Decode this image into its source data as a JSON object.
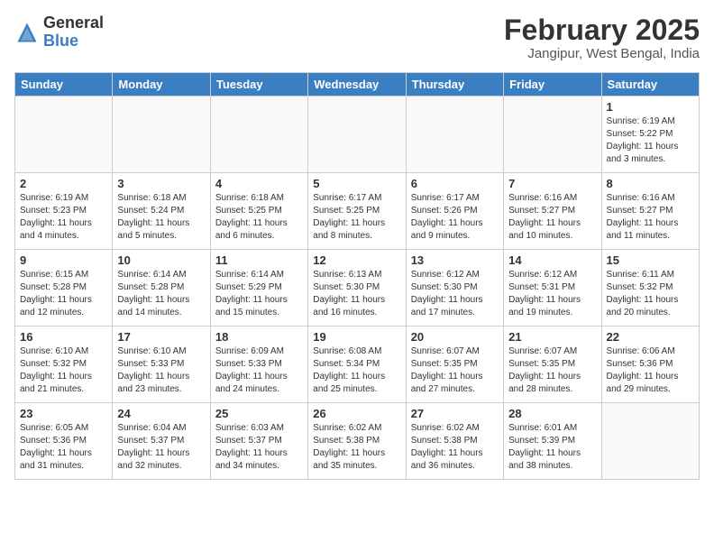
{
  "header": {
    "logo_general": "General",
    "logo_blue": "Blue",
    "month_year": "February 2025",
    "location": "Jangipur, West Bengal, India"
  },
  "weekdays": [
    "Sunday",
    "Monday",
    "Tuesday",
    "Wednesday",
    "Thursday",
    "Friday",
    "Saturday"
  ],
  "weeks": [
    [
      {
        "day": "",
        "info": ""
      },
      {
        "day": "",
        "info": ""
      },
      {
        "day": "",
        "info": ""
      },
      {
        "day": "",
        "info": ""
      },
      {
        "day": "",
        "info": ""
      },
      {
        "day": "",
        "info": ""
      },
      {
        "day": "1",
        "info": "Sunrise: 6:19 AM\nSunset: 5:22 PM\nDaylight: 11 hours\nand 3 minutes."
      }
    ],
    [
      {
        "day": "2",
        "info": "Sunrise: 6:19 AM\nSunset: 5:23 PM\nDaylight: 11 hours\nand 4 minutes."
      },
      {
        "day": "3",
        "info": "Sunrise: 6:18 AM\nSunset: 5:24 PM\nDaylight: 11 hours\nand 5 minutes."
      },
      {
        "day": "4",
        "info": "Sunrise: 6:18 AM\nSunset: 5:25 PM\nDaylight: 11 hours\nand 6 minutes."
      },
      {
        "day": "5",
        "info": "Sunrise: 6:17 AM\nSunset: 5:25 PM\nDaylight: 11 hours\nand 8 minutes."
      },
      {
        "day": "6",
        "info": "Sunrise: 6:17 AM\nSunset: 5:26 PM\nDaylight: 11 hours\nand 9 minutes."
      },
      {
        "day": "7",
        "info": "Sunrise: 6:16 AM\nSunset: 5:27 PM\nDaylight: 11 hours\nand 10 minutes."
      },
      {
        "day": "8",
        "info": "Sunrise: 6:16 AM\nSunset: 5:27 PM\nDaylight: 11 hours\nand 11 minutes."
      }
    ],
    [
      {
        "day": "9",
        "info": "Sunrise: 6:15 AM\nSunset: 5:28 PM\nDaylight: 11 hours\nand 12 minutes."
      },
      {
        "day": "10",
        "info": "Sunrise: 6:14 AM\nSunset: 5:28 PM\nDaylight: 11 hours\nand 14 minutes."
      },
      {
        "day": "11",
        "info": "Sunrise: 6:14 AM\nSunset: 5:29 PM\nDaylight: 11 hours\nand 15 minutes."
      },
      {
        "day": "12",
        "info": "Sunrise: 6:13 AM\nSunset: 5:30 PM\nDaylight: 11 hours\nand 16 minutes."
      },
      {
        "day": "13",
        "info": "Sunrise: 6:12 AM\nSunset: 5:30 PM\nDaylight: 11 hours\nand 17 minutes."
      },
      {
        "day": "14",
        "info": "Sunrise: 6:12 AM\nSunset: 5:31 PM\nDaylight: 11 hours\nand 19 minutes."
      },
      {
        "day": "15",
        "info": "Sunrise: 6:11 AM\nSunset: 5:32 PM\nDaylight: 11 hours\nand 20 minutes."
      }
    ],
    [
      {
        "day": "16",
        "info": "Sunrise: 6:10 AM\nSunset: 5:32 PM\nDaylight: 11 hours\nand 21 minutes."
      },
      {
        "day": "17",
        "info": "Sunrise: 6:10 AM\nSunset: 5:33 PM\nDaylight: 11 hours\nand 23 minutes."
      },
      {
        "day": "18",
        "info": "Sunrise: 6:09 AM\nSunset: 5:33 PM\nDaylight: 11 hours\nand 24 minutes."
      },
      {
        "day": "19",
        "info": "Sunrise: 6:08 AM\nSunset: 5:34 PM\nDaylight: 11 hours\nand 25 minutes."
      },
      {
        "day": "20",
        "info": "Sunrise: 6:07 AM\nSunset: 5:35 PM\nDaylight: 11 hours\nand 27 minutes."
      },
      {
        "day": "21",
        "info": "Sunrise: 6:07 AM\nSunset: 5:35 PM\nDaylight: 11 hours\nand 28 minutes."
      },
      {
        "day": "22",
        "info": "Sunrise: 6:06 AM\nSunset: 5:36 PM\nDaylight: 11 hours\nand 29 minutes."
      }
    ],
    [
      {
        "day": "23",
        "info": "Sunrise: 6:05 AM\nSunset: 5:36 PM\nDaylight: 11 hours\nand 31 minutes."
      },
      {
        "day": "24",
        "info": "Sunrise: 6:04 AM\nSunset: 5:37 PM\nDaylight: 11 hours\nand 32 minutes."
      },
      {
        "day": "25",
        "info": "Sunrise: 6:03 AM\nSunset: 5:37 PM\nDaylight: 11 hours\nand 34 minutes."
      },
      {
        "day": "26",
        "info": "Sunrise: 6:02 AM\nSunset: 5:38 PM\nDaylight: 11 hours\nand 35 minutes."
      },
      {
        "day": "27",
        "info": "Sunrise: 6:02 AM\nSunset: 5:38 PM\nDaylight: 11 hours\nand 36 minutes."
      },
      {
        "day": "28",
        "info": "Sunrise: 6:01 AM\nSunset: 5:39 PM\nDaylight: 11 hours\nand 38 minutes."
      },
      {
        "day": "",
        "info": ""
      }
    ]
  ]
}
